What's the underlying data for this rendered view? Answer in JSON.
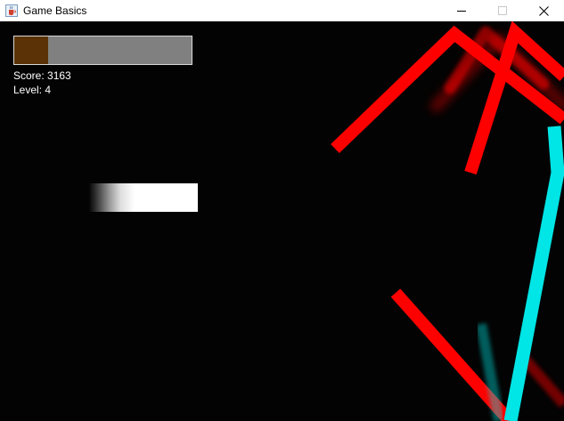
{
  "window": {
    "title": "Game Basics",
    "icon": "java-cup-icon",
    "controls": [
      "minimize-icon",
      "maximize-icon",
      "close-icon"
    ]
  },
  "hud": {
    "health_fraction": 0.19,
    "health_fill_color": "#5a3205",
    "health_track_color": "#808080",
    "score_text": "Score: 3163",
    "level_text": "Level: 4"
  },
  "colors": {
    "background": "#030303",
    "enemy_red": "#ff0000",
    "enemy_cyan": "#00e5e5",
    "player": "#ffffff"
  }
}
